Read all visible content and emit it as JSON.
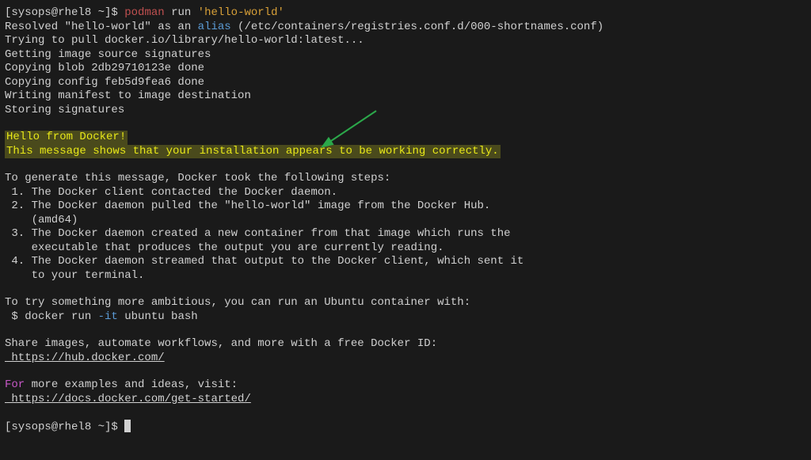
{
  "prompt1": {
    "user": "[sysops@rhel8 ~]$",
    "cmd_part1": "podman",
    "cmd_part2": "run ",
    "cmd_part3": "'hello-world'"
  },
  "output": {
    "resolved": "Resolved \"hello-world\" as an ",
    "alias": "alias",
    "resolved_tail": " (/etc/containers/registries.conf.d/000-shortnames.conf)",
    "pulling": "Trying to pull docker.io/library/hello-world:latest...",
    "signatures": "Getting image source signatures",
    "blob": "Copying blob 2db29710123e done",
    "config": "Copying config feb5d9fea6 done",
    "manifest": "Writing manifest to image destination",
    "storing": "Storing signatures"
  },
  "hello": {
    "l1": "Hello from Docker!",
    "l2": "This message shows that your installation appears to be working correctly."
  },
  "body": {
    "gen": "To generate this message, Docker took the following steps:",
    "s1": " 1. The Docker client contacted the Docker daemon.",
    "s2": " 2. The Docker daemon pulled the \"hello-world\" image from the Docker Hub.",
    "s2b": "    (amd64)",
    "s3": " 3. The Docker daemon created a new container from that image which runs the",
    "s3b": "    executable that produces the output you are currently reading.",
    "s4": " 4. The Docker daemon streamed that output to the Docker client, which sent it",
    "s4b": "    to your terminal.",
    "amb": "To try something more ambitious, you can run an Ubuntu container with:",
    "amb_cmd_pre": " $ docker run ",
    "amb_flag": "-it",
    "amb_cmd_post": " ubuntu bash",
    "share": "Share images, automate workflows, and more with a free Docker ID:",
    "share_url": " https://hub.docker.com/",
    "for": "For",
    "for_tail": " more examples and ideas, visit:",
    "docs_url": " https://docs.docker.com/get-started/"
  },
  "prompt2": "[sysops@rhel8 ~]$ "
}
